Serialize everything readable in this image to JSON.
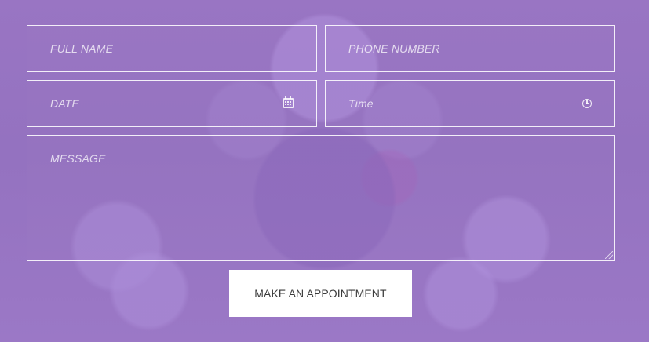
{
  "form": {
    "fields": {
      "full_name_placeholder": "FULL NAME",
      "phone_number_placeholder": "PHONE NUMBER",
      "date_placeholder": "DATE",
      "time_placeholder": "Time",
      "message_placeholder": "MESSAGE"
    },
    "submit_label": "MAKE AN APPOINTMENT"
  }
}
